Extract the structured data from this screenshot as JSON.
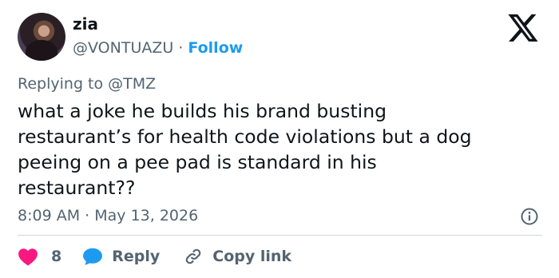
{
  "user": {
    "name": "zia",
    "handle": "@VONTUAZU",
    "separator": "·",
    "follow_label": "Follow"
  },
  "reply": {
    "prefix": "Replying to ",
    "mention": "@TMZ"
  },
  "tweet": {
    "lines": [
      "what a joke he builds his brand busting",
      "restaurant’s for health code violations but a dog",
      "peeing on a pee pad is standard in his",
      "restaurant??"
    ]
  },
  "meta": {
    "time": "8:09 AM",
    "separator": "·",
    "date": "May 13, 2026"
  },
  "actions": {
    "like_count": "8",
    "reply_label": "Reply",
    "copy_label": "Copy link"
  },
  "colors": {
    "like": "#f91880",
    "reply": "#1d9bf0",
    "link": "#1d9bf0",
    "muted": "#536471"
  },
  "icons": {
    "brand": "x-logo-icon",
    "like": "heart-icon",
    "reply": "speech-bubble-icon",
    "copy": "link-icon",
    "info": "info-icon"
  }
}
